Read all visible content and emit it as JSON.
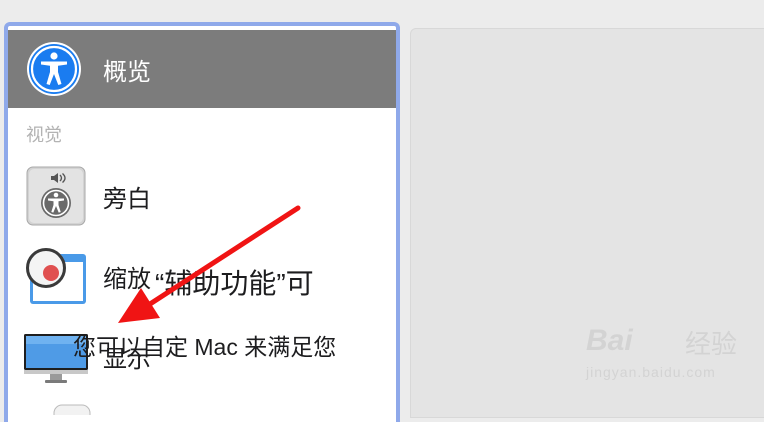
{
  "sidebar": {
    "selected_label": "概览",
    "section_header": "视觉",
    "items": [
      {
        "label": "旁白",
        "icon": "voiceover-icon"
      },
      {
        "label": "缩放",
        "icon": "zoom-icon"
      },
      {
        "label": "显示",
        "icon": "display-icon"
      }
    ]
  },
  "main": {
    "title": "“辅助功能”可",
    "description": "您可以自定 Mac 来满足您"
  },
  "watermark": {
    "brand": "Bai",
    "sub": "经验",
    "url": "jingyan.baidu.com"
  },
  "colors": {
    "selection": "#7c7c7c",
    "sidebar_border": "#8fa9ea",
    "accent_blue": "#1a7cf0",
    "arrow": "#f01414"
  }
}
